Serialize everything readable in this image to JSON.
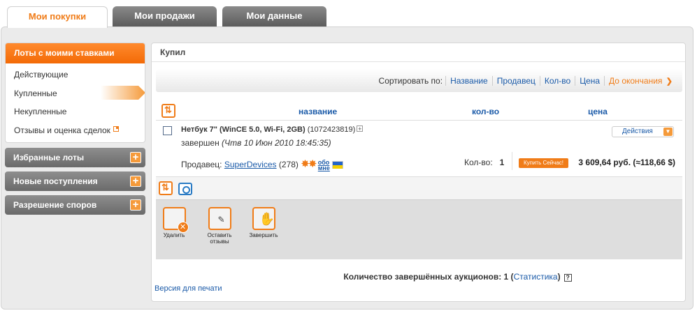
{
  "tabs": [
    {
      "label": "Мои покупки",
      "active": true
    },
    {
      "label": "Мои продажи",
      "active": false
    },
    {
      "label": "Мои данные",
      "active": false
    }
  ],
  "sidebar": {
    "header": "Лоты с моими ставками",
    "items": [
      "Действующие",
      "Купленные",
      "Некупленные",
      "Отзывы и оценка сделок"
    ],
    "selected": "Купленные",
    "sections": [
      "Избранные лоты",
      "Новые поступления",
      "Разрешение споров"
    ]
  },
  "main": {
    "title": "Купил",
    "sort": {
      "label": "Сортировать по:",
      "options": [
        "Название",
        "Продавец",
        "Кол-во",
        "Цена",
        "До окончания"
      ],
      "active": "До окончания"
    },
    "columns": [
      "название",
      "кол-во",
      "цена"
    ],
    "lot": {
      "name": "Нетбук 7\" (WinCE 5.0, Wi-Fi, 2GB)",
      "id": "(1072423819)",
      "status": "завершен",
      "date": "(Чтв 10 Июн 2010 18:45:35)",
      "seller_label": "Продавец:",
      "seller": "SuperDevices",
      "rating": "(278)",
      "abo_line1": "обо",
      "abo_line2": "мне",
      "actions": "Действия",
      "qty_label": "Кол-во:",
      "qty": "1",
      "buy_now": "Купить Сейчас!",
      "price": "3 609,64 руб. (≈118,66 $)"
    },
    "tools": [
      {
        "label": "Удалить",
        "icon": "delete-icon"
      },
      {
        "label": "Оставить отзывы",
        "icon": "feedback-icon"
      },
      {
        "label": "Завершить",
        "icon": "finish-icon"
      }
    ],
    "summary": {
      "text": "Количество завершённых аукционов: 1",
      "link": "Статистика",
      "help": "?"
    },
    "print": "Версия для печати"
  },
  "colors": {
    "accent": "#f07c18",
    "link": "#1a5aa8",
    "tab_dark": "#6a6a6a"
  }
}
